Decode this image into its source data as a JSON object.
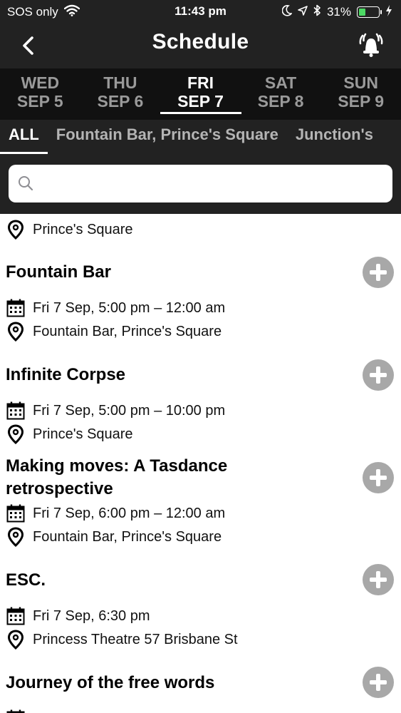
{
  "status": {
    "carrier": "SOS only",
    "time": "11:43 pm",
    "battery": "31%",
    "battery_level": 0.31,
    "icons": [
      "wifi-icon",
      "moon-icon",
      "location-arrow-icon",
      "bluetooth-icon",
      "battery-icon",
      "charging-icon"
    ]
  },
  "header": {
    "title": "Schedule",
    "back_icon": "chevron-left-icon",
    "alarm_icon": "alarm-bell-icon"
  },
  "days": [
    {
      "dow": "WED",
      "date": "SEP 5"
    },
    {
      "dow": "THU",
      "date": "SEP 6"
    },
    {
      "dow": "FRI",
      "date": "SEP 7",
      "active": true
    },
    {
      "dow": "SAT",
      "date": "SEP 8"
    },
    {
      "dow": "SUN",
      "date": "SEP 9"
    }
  ],
  "venues": [
    "ALL",
    "Fountain Bar, Prince's Square",
    "Junction's"
  ],
  "search": {
    "placeholder": "",
    "value": ""
  },
  "partial_location": "Prince's Square",
  "events": [
    {
      "title": "Fountain Bar",
      "time": "Fri 7 Sep, 5:00 pm – 12:00 am",
      "location": "Fountain Bar, Prince's Square"
    },
    {
      "title": "Infinite Corpse",
      "time": "Fri 7 Sep, 5:00 pm – 10:00 pm",
      "location": "Prince's Square"
    },
    {
      "title": "Making moves: A Tasdance retrospective",
      "time": "Fri 7 Sep, 6:00 pm – 12:00 am",
      "location": "Fountain Bar, Prince's Square"
    },
    {
      "title": "ESC.",
      "time": "Fri 7 Sep, 6:30 pm",
      "location": "Princess Theatre 57 Brisbane St"
    },
    {
      "title": "Journey of the free words",
      "time": "",
      "location": ""
    }
  ],
  "colors": {
    "header_bg": "#222222",
    "tabs_bg": "#111111",
    "add_button": "#a8a8a8",
    "battery_fill": "#4cd964"
  }
}
